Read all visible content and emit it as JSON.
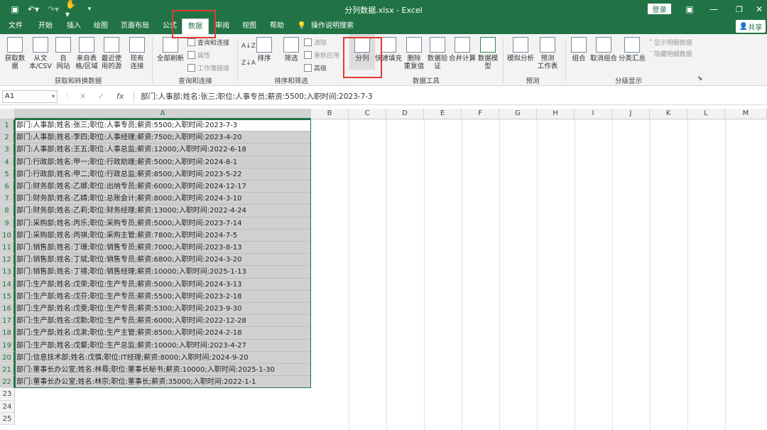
{
  "titlebar": {
    "doc_title": "分列数据.xlsx  -  Excel",
    "login_label": "登录",
    "share_label": "共享"
  },
  "tabs": [
    "文件",
    "开始",
    "插入",
    "绘图",
    "页面布局",
    "公式",
    "数据",
    "审阅",
    "视图",
    "帮助"
  ],
  "active_tab": "数据",
  "search_hint": "操作说明搜索",
  "ribbon": {
    "groups": [
      {
        "label": "获取和转换数据"
      },
      {
        "label": "查询和连接"
      },
      {
        "label": "排序和筛选"
      },
      {
        "label": "数据工具"
      },
      {
        "label": "预测"
      },
      {
        "label": "分级显示"
      }
    ],
    "get_data": {
      "btn1": "获取数",
      "btn1b": "据",
      "btn2": "从文",
      "btn2b": "本/CSV",
      "btn3": "自",
      "btn3b": "网站",
      "btn4": "来自表",
      "btn4b": "格/区域",
      "btn5": "最近使",
      "btn5b": "用的源",
      "btn6": "现有",
      "btn6b": "连接"
    },
    "queries": {
      "refresh": "全部刷新",
      "queries_connections": "查询和连接",
      "properties": "属性",
      "edit_links": "工作簿链接"
    },
    "sort": {
      "az": "A↓Z",
      "za": "Z↓A",
      "sort": "排序",
      "filter": "筛选",
      "clear": "清除",
      "reapply": "重新应用",
      "advanced": "高级"
    },
    "tools": {
      "text_to_columns": "分列",
      "flash_fill": "快速填充",
      "remove_dup": "删除",
      "remove_dup_b": "重复值",
      "validation": "数据验",
      "validation_b": "证",
      "consolidate": "合并计算",
      "model": "数据模",
      "model_b": "型"
    },
    "forecast": {
      "whatif": "模拟分析",
      "sheet": "预测",
      "sheet_b": "工作表"
    },
    "outline": {
      "group": "组合",
      "ungroup": "取消组合",
      "subtotal": "分类汇总",
      "show_detail": "显示明细数据",
      "hide_detail": "隐藏明细数据"
    }
  },
  "formula_bar": {
    "name_box": "A1",
    "fx": "fx",
    "formula": "部门:人事部;姓名:张三;职位:人事专员;薪资:5500;入职时间:2023-7-3"
  },
  "columns": [
    "A",
    "B",
    "C",
    "D",
    "E",
    "F",
    "G",
    "H",
    "I",
    "J",
    "K",
    "L",
    "M"
  ],
  "rows": [
    "部门:人事部;姓名:张三;职位:人事专员;薪资:5500;入职时间:2023-7-3",
    "部门:人事部;姓名:李四;职位:人事经理;薪资:7500;入职时间:2023-4-20",
    "部门:人事部;姓名:王五;职位:人事总监;薪资:12000;入职时间:2022-6-18",
    "部门:行政部;姓名:甲一;职位:行政助理;薪资:5000;入职时间:2024-8-1",
    "部门:行政部;姓名:甲二;职位:行政总监;薪资:8500;入职时间:2023-5-22",
    "部门:财务部;姓名:乙娜;职位:出纳专员;薪资:6000;入职时间:2024-12-17",
    "部门:财务部;姓名:乙婧;职位:总账会计;薪资:8000;入职时间:2024-3-10",
    "部门:财务部;姓名:乙莉;职位:财务经理;薪资:13000;入职时间:2022-4-24",
    "部门:采购部;姓名:丙乐;职位:采购专员;薪资:5000;入职时间:2023-7-14",
    "部门:采购部;姓名:丙祺;职位:采购主管;薪资:7800;入职时间:2024-7-5",
    "部门:销售部;姓名:丁珊;职位:销售专员;薪资:7000;入职时间:2023-8-13",
    "部门:销售部;姓名:丁斌;职位:销售专员;薪资:6800;入职时间:2024-3-20",
    "部门:销售部;姓名:丁禧;职位:销售经理;薪资:10000;入职时间:2025-1-13",
    "部门:生产部;姓名:戊荣;职位:生产专员;薪资:5000;入职时间:2024-3-13",
    "部门:生产部;姓名:戊芬;职位:生产专员;薪资:5500;入职时间:2023-2-18",
    "部门:生产部;姓名:戊雯;职位:生产专员;薪资:5300;入职时间:2023-9-30",
    "部门:生产部;姓名:戊勤;职位:生产专员;薪资:6000;入职时间:2022-12-28",
    "部门:生产部;姓名:戊漱;职位:生产主管;薪资:8500;入职时间:2024-2-18",
    "部门:生产部;姓名:戊颦;职位:生产总监;薪资:10000;入职时间:2023-4-27",
    "部门:信息技术部;姓名:戊慎;职位:IT经理;薪资:8000;入职时间:2024-9-20",
    "部门:董事长办公室;姓名:林蓦;职位:董事长秘书;薪资:10000;入职时间:2025-1-30",
    "部门:董事长办公室;姓名:林宗;职位:董事长;薪资:35000;入职时间:2022-1-1"
  ],
  "empty_row_numbers": [
    "23",
    "24",
    "25"
  ],
  "colors": {
    "accent": "#217346",
    "highlight": "#e53935",
    "selection_fill": "#d0d0d0"
  }
}
